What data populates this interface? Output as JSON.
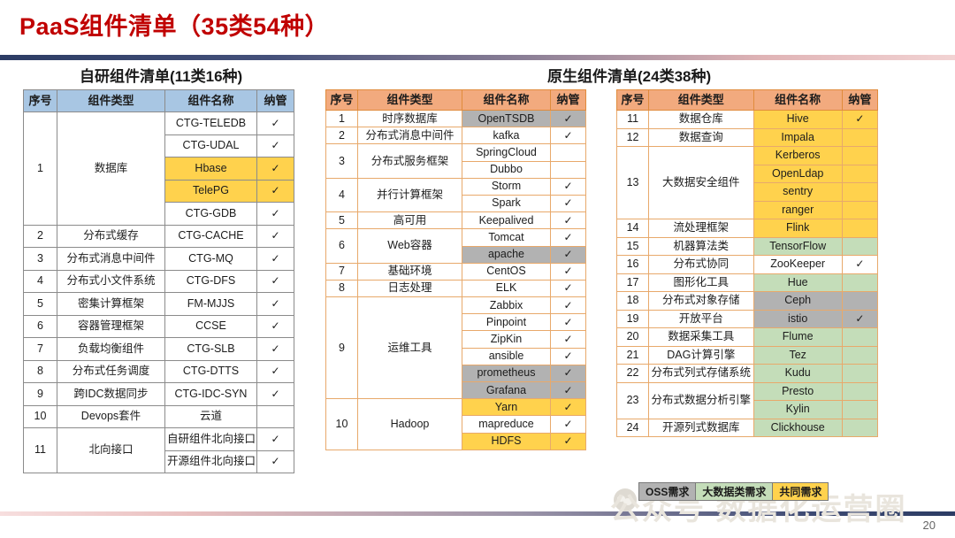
{
  "slide": {
    "title": "PaaS组件清单（35类54种）",
    "page_number": "20"
  },
  "legend": {
    "items": [
      {
        "label": "OSS需求",
        "color": "#b2b2b2"
      },
      {
        "label": "大数据类需求",
        "color": "#c4ddb9"
      },
      {
        "label": "共同需求",
        "color": "#ffd24d"
      }
    ]
  },
  "watermark": {
    "text": "公众号 数据化运营圈"
  },
  "self_developed": {
    "heading": "自研组件清单(11类16种)",
    "columns": [
      "序号",
      "组件类型",
      "组件名称",
      "纳管"
    ],
    "header_color": "#a8c6e3",
    "rows": [
      {
        "no": "1",
        "type": "数据库",
        "rowspan": 5,
        "names": [
          {
            "name": "CTG-TELEDB",
            "managed": "✓",
            "hl": ""
          },
          {
            "name": "CTG-UDAL",
            "managed": "✓",
            "hl": ""
          },
          {
            "name": "Hbase",
            "managed": "✓",
            "hl": "hl-yellow"
          },
          {
            "name": "TelePG",
            "managed": "✓",
            "hl": "hl-yellow"
          },
          {
            "name": "CTG-GDB",
            "managed": "✓",
            "hl": ""
          }
        ]
      },
      {
        "no": "2",
        "type": "分布式缓存",
        "rowspan": 1,
        "names": [
          {
            "name": "CTG-CACHE",
            "managed": "✓",
            "hl": ""
          }
        ]
      },
      {
        "no": "3",
        "type": "分布式消息中间件",
        "rowspan": 1,
        "names": [
          {
            "name": "CTG-MQ",
            "managed": "✓",
            "hl": ""
          }
        ]
      },
      {
        "no": "4",
        "type": "分布式小文件系统",
        "rowspan": 1,
        "names": [
          {
            "name": "CTG-DFS",
            "managed": "✓",
            "hl": ""
          }
        ]
      },
      {
        "no": "5",
        "type": "密集计算框架",
        "rowspan": 1,
        "names": [
          {
            "name": "FM-MJJS",
            "managed": "✓",
            "hl": ""
          }
        ]
      },
      {
        "no": "6",
        "type": "容器管理框架",
        "rowspan": 1,
        "names": [
          {
            "name": "CCSE",
            "managed": "✓",
            "hl": ""
          }
        ]
      },
      {
        "no": "7",
        "type": "负载均衡组件",
        "rowspan": 1,
        "names": [
          {
            "name": "CTG-SLB",
            "managed": "✓",
            "hl": ""
          }
        ]
      },
      {
        "no": "8",
        "type": "分布式任务调度",
        "rowspan": 1,
        "names": [
          {
            "name": "CTG-DTTS",
            "managed": "✓",
            "hl": ""
          }
        ]
      },
      {
        "no": "9",
        "type": "跨IDC数据同步",
        "rowspan": 1,
        "names": [
          {
            "name": "CTG-IDC-SYN",
            "managed": "✓",
            "hl": ""
          }
        ]
      },
      {
        "no": "10",
        "type": "Devops套件",
        "rowspan": 1,
        "names": [
          {
            "name": "云道",
            "managed": "",
            "hl": ""
          }
        ]
      },
      {
        "no": "11",
        "type": "北向接口",
        "rowspan": 2,
        "names": [
          {
            "name": "自研组件北向接口",
            "managed": "✓",
            "hl": ""
          },
          {
            "name": "开源组件北向接口",
            "managed": "✓",
            "hl": ""
          }
        ]
      }
    ]
  },
  "native": {
    "heading": "原生组件清单(24类38种)",
    "columns": [
      "序号",
      "组件类型",
      "组件名称",
      "纳管"
    ],
    "header_color": "#f2aa7e",
    "left_rows": [
      {
        "no": "1",
        "type": "时序数据库",
        "rowspan": 1,
        "names": [
          {
            "name": "OpenTSDB",
            "managed": "✓",
            "hl": "hl-gray"
          }
        ]
      },
      {
        "no": "2",
        "type": "分布式消息中间件",
        "rowspan": 1,
        "names": [
          {
            "name": "kafka",
            "managed": "✓",
            "hl": ""
          }
        ]
      },
      {
        "no": "3",
        "type": "分布式服务框架",
        "rowspan": 2,
        "names": [
          {
            "name": "SpringCloud",
            "managed": "",
            "hl": ""
          },
          {
            "name": "Dubbo",
            "managed": "",
            "hl": ""
          }
        ]
      },
      {
        "no": "4",
        "type": "并行计算框架",
        "rowspan": 2,
        "names": [
          {
            "name": "Storm",
            "managed": "✓",
            "hl": ""
          },
          {
            "name": "Spark",
            "managed": "✓",
            "hl": ""
          }
        ]
      },
      {
        "no": "5",
        "type": "高可用",
        "rowspan": 1,
        "names": [
          {
            "name": "Keepalived",
            "managed": "✓",
            "hl": ""
          }
        ]
      },
      {
        "no": "6",
        "type": "Web容器",
        "rowspan": 2,
        "names": [
          {
            "name": "Tomcat",
            "managed": "✓",
            "hl": ""
          },
          {
            "name": "apache",
            "managed": "✓",
            "hl": "hl-gray"
          }
        ]
      },
      {
        "no": "7",
        "type": "基础环境",
        "rowspan": 1,
        "names": [
          {
            "name": "CentOS",
            "managed": "✓",
            "hl": ""
          }
        ]
      },
      {
        "no": "8",
        "type": "日志处理",
        "rowspan": 1,
        "names": [
          {
            "name": "ELK",
            "managed": "✓",
            "hl": ""
          }
        ]
      },
      {
        "no": "9",
        "type": "运维工具",
        "rowspan": 6,
        "names": [
          {
            "name": "Zabbix",
            "managed": "✓",
            "hl": ""
          },
          {
            "name": "Pinpoint",
            "managed": "✓",
            "hl": ""
          },
          {
            "name": "ZipKin",
            "managed": "✓",
            "hl": ""
          },
          {
            "name": "ansible",
            "managed": "✓",
            "hl": ""
          },
          {
            "name": "prometheus",
            "managed": "✓",
            "hl": "hl-gray"
          },
          {
            "name": "Grafana",
            "managed": "✓",
            "hl": "hl-gray"
          }
        ]
      },
      {
        "no": "10",
        "type": "Hadoop",
        "rowspan": 3,
        "names": [
          {
            "name": "Yarn",
            "managed": "✓",
            "hl": "hl-yellow"
          },
          {
            "name": "mapreduce",
            "managed": "✓",
            "hl": ""
          },
          {
            "name": "HDFS",
            "managed": "✓",
            "hl": "hl-yellow"
          }
        ]
      }
    ],
    "right_rows": [
      {
        "no": "11",
        "type": "数据仓库",
        "rowspan": 1,
        "names": [
          {
            "name": "Hive",
            "managed": "✓",
            "hl": "hl-yellow",
            "mhl": "hl-yellow"
          }
        ]
      },
      {
        "no": "12",
        "type": "数据查询",
        "rowspan": 1,
        "names": [
          {
            "name": "Impala",
            "managed": "",
            "hl": "hl-yellow",
            "mhl": "hl-yellow"
          }
        ]
      },
      {
        "no": "13",
        "type": "大数据安全组件",
        "rowspan": 4,
        "names": [
          {
            "name": "Kerberos",
            "managed": "",
            "hl": "hl-yellow",
            "mhl": "hl-yellow"
          },
          {
            "name": "OpenLdap",
            "managed": "",
            "hl": "hl-yellow",
            "mhl": "hl-yellow"
          },
          {
            "name": "sentry",
            "managed": "",
            "hl": "hl-yellow",
            "mhl": "hl-yellow"
          },
          {
            "name": "ranger",
            "managed": "",
            "hl": "hl-yellow",
            "mhl": "hl-yellow"
          }
        ]
      },
      {
        "no": "14",
        "type": "流处理框架",
        "rowspan": 1,
        "names": [
          {
            "name": "Flink",
            "managed": "",
            "hl": "hl-yellow",
            "mhl": "hl-yellow"
          }
        ]
      },
      {
        "no": "15",
        "type": "机器算法类",
        "rowspan": 1,
        "names": [
          {
            "name": "TensorFlow",
            "managed": "",
            "hl": "hl-green",
            "mhl": "hl-green"
          }
        ]
      },
      {
        "no": "16",
        "type": "分布式协同",
        "rowspan": 1,
        "names": [
          {
            "name": "ZooKeeper",
            "managed": "✓",
            "hl": "",
            "mhl": ""
          }
        ]
      },
      {
        "no": "17",
        "type": "图形化工具",
        "rowspan": 1,
        "names": [
          {
            "name": "Hue",
            "managed": "",
            "hl": "hl-green",
            "mhl": "hl-green"
          }
        ]
      },
      {
        "no": "18",
        "type": "分布式对象存储",
        "rowspan": 1,
        "names": [
          {
            "name": "Ceph",
            "managed": "",
            "hl": "hl-gray",
            "mhl": "hl-gray"
          }
        ]
      },
      {
        "no": "19",
        "type": "开放平台",
        "rowspan": 1,
        "names": [
          {
            "name": "istio",
            "managed": "✓",
            "hl": "hl-gray",
            "mhl": "hl-gray"
          }
        ]
      },
      {
        "no": "20",
        "type": "数据采集工具",
        "rowspan": 1,
        "names": [
          {
            "name": "Flume",
            "managed": "",
            "hl": "hl-green",
            "mhl": "hl-green"
          }
        ]
      },
      {
        "no": "21",
        "type": "DAG计算引擎",
        "rowspan": 1,
        "names": [
          {
            "name": "Tez",
            "managed": "",
            "hl": "hl-green",
            "mhl": "hl-green"
          }
        ]
      },
      {
        "no": "22",
        "type": "分布式列式存储系统",
        "rowspan": 1,
        "names": [
          {
            "name": "Kudu",
            "managed": "",
            "hl": "hl-green",
            "mhl": "hl-green"
          }
        ]
      },
      {
        "no": "23",
        "type": "分布式数据分析引擎",
        "rowspan": 2,
        "names": [
          {
            "name": "Presto",
            "managed": "",
            "hl": "hl-green",
            "mhl": "hl-green"
          },
          {
            "name": "Kylin",
            "managed": "",
            "hl": "hl-green",
            "mhl": "hl-green"
          }
        ]
      },
      {
        "no": "24",
        "type": "开源列式数据库",
        "rowspan": 1,
        "names": [
          {
            "name": "Clickhouse",
            "managed": "",
            "hl": "hl-green",
            "mhl": "hl-green"
          }
        ]
      }
    ]
  }
}
